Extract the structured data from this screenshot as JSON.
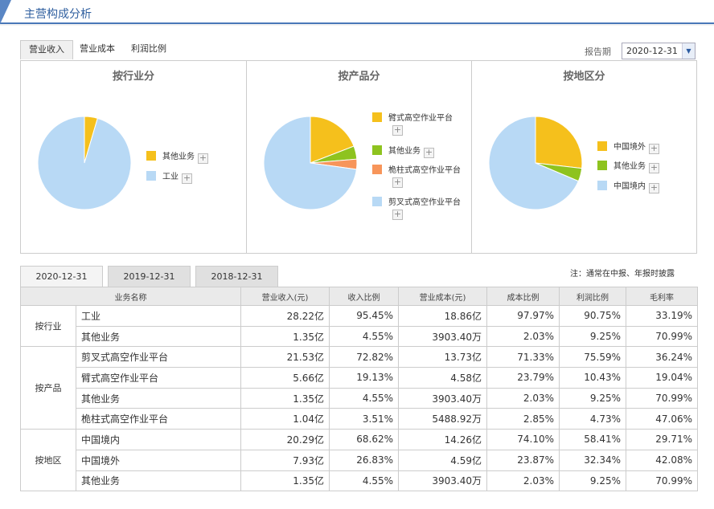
{
  "header": {
    "title": "主营构成分析"
  },
  "top_tabs": [
    "营业收入",
    "营业成本",
    "利润比例"
  ],
  "period": {
    "label": "报告期",
    "value": "2020-12-31"
  },
  "colors": {
    "yellow": "#f5c01c",
    "green": "#8ec31f",
    "orange": "#f7955a",
    "blue": "#b8d9f5"
  },
  "charts": [
    {
      "title": "按行业分",
      "legend": [
        {
          "label": "其他业务",
          "color": "#f5c01c"
        },
        {
          "label": "工业",
          "color": "#b8d9f5"
        }
      ]
    },
    {
      "title": "按产品分",
      "legend": [
        {
          "label": "臂式高空作业平台",
          "color": "#f5c01c"
        },
        {
          "label": "其他业务",
          "color": "#8ec31f"
        },
        {
          "label": "桅柱式高空作业平台",
          "color": "#f7955a"
        },
        {
          "label": "剪叉式高空作业平台",
          "color": "#b8d9f5"
        }
      ]
    },
    {
      "title": "按地区分",
      "legend": [
        {
          "label": "中国境外",
          "color": "#f5c01c"
        },
        {
          "label": "其他业务",
          "color": "#8ec31f"
        },
        {
          "label": "中国境内",
          "color": "#b8d9f5"
        }
      ]
    }
  ],
  "chart_data": [
    {
      "type": "pie",
      "categories": [
        "其他业务",
        "工业"
      ],
      "values": [
        4.55,
        95.45
      ]
    },
    {
      "type": "pie",
      "categories": [
        "臂式高空作业平台",
        "其他业务",
        "桅柱式高空作业平台",
        "剪叉式高空作业平台"
      ],
      "values": [
        19.13,
        4.55,
        3.51,
        72.82
      ]
    },
    {
      "type": "pie",
      "categories": [
        "中国境外",
        "其他业务",
        "中国境内"
      ],
      "values": [
        26.83,
        4.55,
        68.62
      ]
    }
  ],
  "year_tabs": [
    "2020-12-31",
    "2019-12-31",
    "2018-12-31"
  ],
  "note": "注：通常在中报、年报时披露",
  "table": {
    "headers": [
      "业务名称",
      "营业收入(元)",
      "收入比例",
      "营业成本(元)",
      "成本比例",
      "利润比例",
      "毛利率"
    ],
    "groups": [
      {
        "name": "按行业",
        "rows": [
          [
            "工业",
            "28.22亿",
            "95.45%",
            "18.86亿",
            "97.97%",
            "90.75%",
            "33.19%"
          ],
          [
            "其他业务",
            "1.35亿",
            "4.55%",
            "3903.40万",
            "2.03%",
            "9.25%",
            "70.99%"
          ]
        ]
      },
      {
        "name": "按产品",
        "rows": [
          [
            "剪叉式高空作业平台",
            "21.53亿",
            "72.82%",
            "13.73亿",
            "71.33%",
            "75.59%",
            "36.24%"
          ],
          [
            "臂式高空作业平台",
            "5.66亿",
            "19.13%",
            "4.58亿",
            "23.79%",
            "10.43%",
            "19.04%"
          ],
          [
            "其他业务",
            "1.35亿",
            "4.55%",
            "3903.40万",
            "2.03%",
            "9.25%",
            "70.99%"
          ],
          [
            "桅柱式高空作业平台",
            "1.04亿",
            "3.51%",
            "5488.92万",
            "2.85%",
            "4.73%",
            "47.06%"
          ]
        ]
      },
      {
        "name": "按地区",
        "rows": [
          [
            "中国境内",
            "20.29亿",
            "68.62%",
            "14.26亿",
            "74.10%",
            "58.41%",
            "29.71%"
          ],
          [
            "中国境外",
            "7.93亿",
            "26.83%",
            "4.59亿",
            "23.87%",
            "32.34%",
            "42.08%"
          ],
          [
            "其他业务",
            "1.35亿",
            "4.55%",
            "3903.40万",
            "2.03%",
            "9.25%",
            "70.99%"
          ]
        ]
      }
    ]
  }
}
